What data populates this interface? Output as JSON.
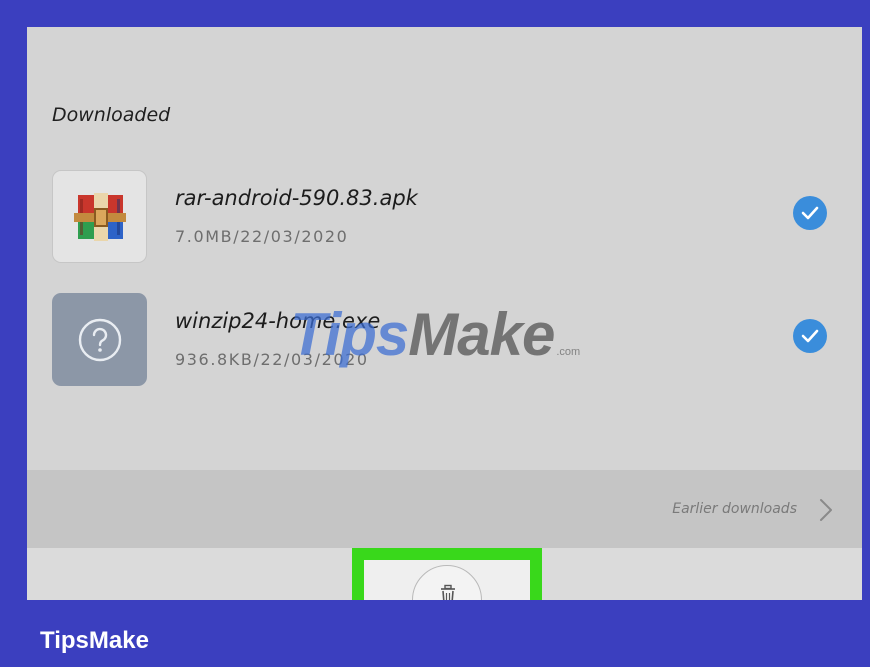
{
  "section": {
    "title": "Downloaded"
  },
  "downloads": [
    {
      "name": "rar-android-590.83.apk",
      "meta": "7.0MB/22/03/2020",
      "icon": "winrar-icon",
      "selected": true
    },
    {
      "name": "winzip24-home.exe",
      "meta": "936.8KB/22/03/2020",
      "icon": "unknown-file-icon",
      "selected": true
    }
  ],
  "earlier": {
    "label": "Earlier downloads",
    "icon": "chevron-right-icon"
  },
  "actions": {
    "delete_icon": "trash-icon",
    "highlighted": true
  },
  "watermark": {
    "tips": "Tips",
    "make": "Make",
    "com": ".com"
  },
  "footer": {
    "brand": "TipsMake"
  },
  "colors": {
    "frame": "#3b3fbf",
    "screen": "#d4d4d4",
    "earlier_band": "#c5c5c5",
    "check": "#3a8ddb",
    "highlight": "#39d81b"
  }
}
